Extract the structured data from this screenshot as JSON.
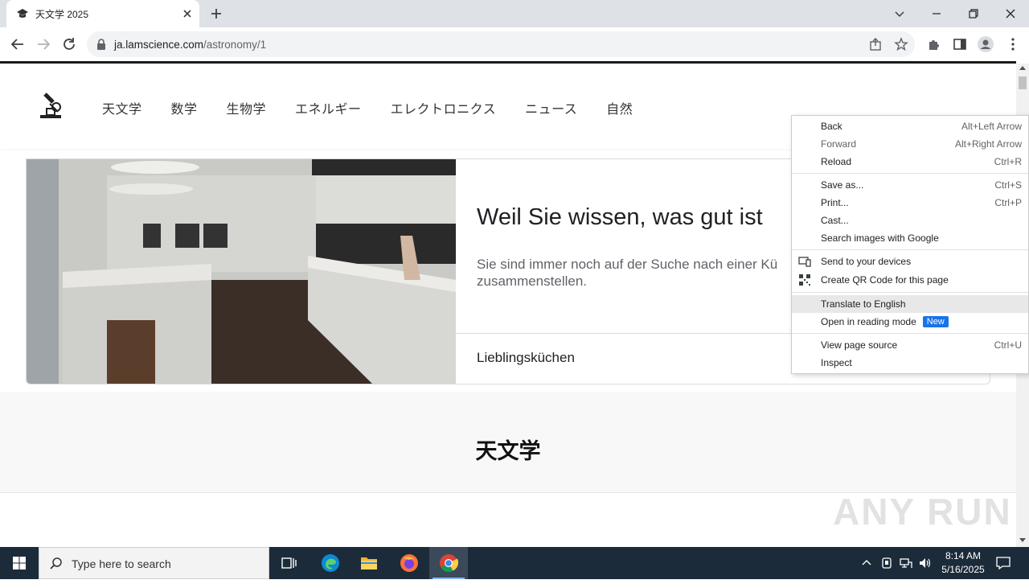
{
  "browser": {
    "tab_title": "天文学 2025",
    "url_host": "ja.lamscience.com",
    "url_path": "/astronomy/1"
  },
  "site": {
    "nav": [
      "天文学",
      "数学",
      "生物学",
      "エネルギー",
      "エレクトロニクス",
      "ニュース",
      "自然"
    ]
  },
  "ad": {
    "title": "Weil Sie wissen, was gut ist",
    "description": "Sie sind immer noch auf der Suche nach einer Kü zusammenstellen.",
    "link": "Lieblingsküchen"
  },
  "section": {
    "title": "天文学"
  },
  "watermark": "ANY RUN",
  "context_menu": {
    "back": {
      "label": "Back",
      "shortcut": "Alt+Left Arrow"
    },
    "forward": {
      "label": "Forward",
      "shortcut": "Alt+Right Arrow"
    },
    "reload": {
      "label": "Reload",
      "shortcut": "Ctrl+R"
    },
    "save_as": {
      "label": "Save as...",
      "shortcut": "Ctrl+S"
    },
    "print": {
      "label": "Print...",
      "shortcut": "Ctrl+P"
    },
    "cast": {
      "label": "Cast..."
    },
    "search_images": {
      "label": "Search images with Google"
    },
    "send_devices": {
      "label": "Send to your devices"
    },
    "qr_code": {
      "label": "Create QR Code for this page"
    },
    "translate": {
      "label": "Translate to English"
    },
    "reading_mode": {
      "label": "Open in reading mode",
      "badge": "New"
    },
    "view_source": {
      "label": "View page source",
      "shortcut": "Ctrl+U"
    },
    "inspect": {
      "label": "Inspect"
    }
  },
  "taskbar": {
    "search_placeholder": "Type here to search",
    "time": "8:14 AM",
    "date": "5/16/2025"
  },
  "colors": {
    "taskbar_bg": "#1c2b3a",
    "accent": "#1a73e8",
    "tabstrip_bg": "#dee1e6"
  }
}
